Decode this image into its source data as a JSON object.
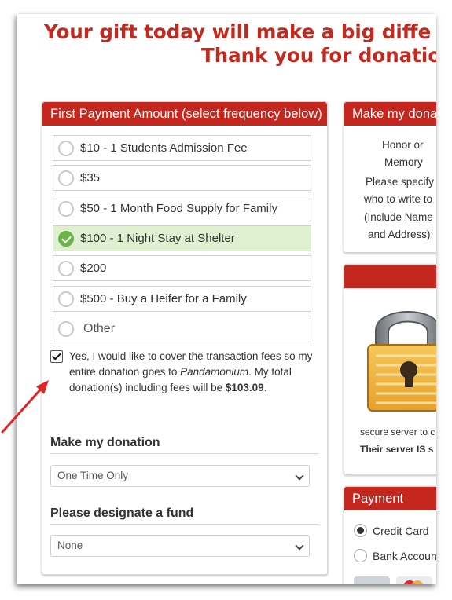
{
  "headline": {
    "line1": "Your gift today will make a big diffe",
    "line2": "Thank you for donatio"
  },
  "amount_panel": {
    "title": "First Payment Amount (select frequency below)",
    "options": [
      {
        "label": "$10 - 1 Students Admission Fee",
        "selected": false
      },
      {
        "label": "$35",
        "selected": false
      },
      {
        "label": "$50 - 1 Month Food Supply for Family",
        "selected": false
      },
      {
        "label": "$100 - 1 Night Stay at Shelter",
        "selected": true
      },
      {
        "label": "$200",
        "selected": false
      },
      {
        "label": "$500 - Buy a Heifer for a Family",
        "selected": false
      },
      {
        "label": "Other",
        "selected": false
      }
    ],
    "fee_checkbox": {
      "checked": true,
      "text_before": "Yes, I would like to cover the transaction fees so my entire donation goes to ",
      "org_name": "Pandamonium",
      "text_middle": ". My total donation(s) including fees will be ",
      "total": "$103.09",
      "text_end": "."
    },
    "frequency": {
      "title": "Make my donation",
      "value": "One Time Only"
    },
    "fund": {
      "title": "Please designate a fund",
      "value": "None"
    }
  },
  "honor_panel": {
    "title": "Make my dona",
    "line1": "Honor or",
    "line2": "Memory",
    "line3": "Please specify",
    "line4": "who to write to",
    "line5": "(Include Name",
    "line6": "and Address):"
  },
  "secure_panel": {
    "text1": "secure server to c",
    "text2": "Their server IS s"
  },
  "payment_panel": {
    "title": "Payment",
    "methods": [
      {
        "label": "Credit Card",
        "selected": true
      },
      {
        "label": "Bank Accoun",
        "selected": false
      }
    ]
  },
  "colors": {
    "accent_red": "#c4271d",
    "selected_green": "#6ab44a",
    "selected_bg": "#dff0d0"
  }
}
